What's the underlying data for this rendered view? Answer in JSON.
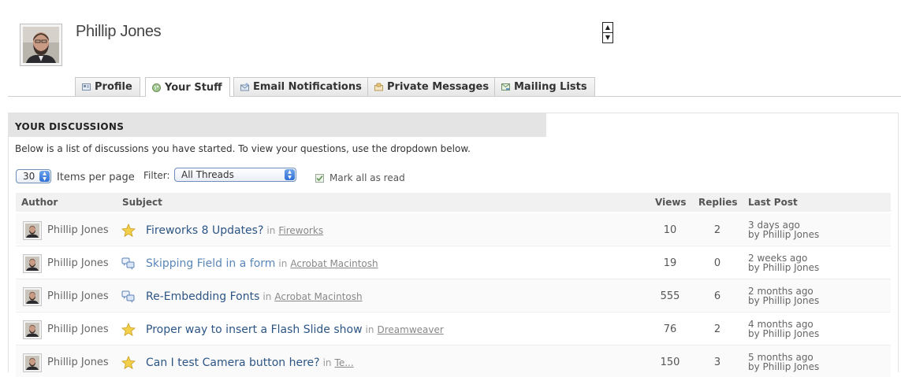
{
  "profile": {
    "name": "Phillip Jones"
  },
  "tabs": [
    {
      "label": "Profile",
      "icon": "profile-card-icon",
      "active": false
    },
    {
      "label": "Your Stuff",
      "icon": "globe-icon",
      "active": true
    },
    {
      "label": "Email Notifications",
      "icon": "email-icon",
      "active": false
    },
    {
      "label": "Private Messages",
      "icon": "private-message-icon",
      "active": false
    },
    {
      "label": "Mailing Lists",
      "icon": "mailing-list-icon",
      "active": false
    }
  ],
  "section": {
    "title": "YOUR DISCUSSIONS",
    "description": "Below is a list of discussions you have started. To view your questions, use the dropdown below."
  },
  "controls": {
    "per_page_value": "30",
    "per_page_label": "Items per page",
    "filter_label": "Filter:",
    "filter_value": "All Threads",
    "mark_all_label": "Mark all as read"
  },
  "table": {
    "headers": {
      "author": "Author",
      "subject": "Subject",
      "views": "Views",
      "replies": "Replies",
      "last_post": "Last Post"
    },
    "in_word": "in",
    "rows": [
      {
        "author": "Phillip Jones",
        "icon": "star-icon",
        "subject": "Fireworks 8 Updates?",
        "category": "Fireworks",
        "views": "10",
        "replies": "2",
        "last_when": "3 days ago",
        "last_by": "by Phillip Jones"
      },
      {
        "author": "Phillip Jones",
        "icon": "discussion-icon",
        "subject": "Skipping Field in a form",
        "category": "Acrobat Macintosh",
        "views": "19",
        "replies": "0",
        "last_when": "2 weeks ago",
        "last_by": "by Phillip Jones"
      },
      {
        "author": "Phillip Jones",
        "icon": "discussion-icon",
        "subject": "Re-Embedding Fonts",
        "category": "Acrobat Macintosh",
        "views": "555",
        "replies": "6",
        "last_when": "2 months ago",
        "last_by": "by Phillip Jones"
      },
      {
        "author": "Phillip Jones",
        "icon": "star-icon",
        "subject": "Proper way to insert a Flash Slide show",
        "category": "Dreamweaver",
        "views": "76",
        "replies": "2",
        "last_when": "4 months ago",
        "last_by": "by Phillip Jones"
      },
      {
        "author": "Phillip Jones",
        "icon": "star-icon",
        "subject": "Can I test Camera button here?",
        "category": "Te...",
        "views": "150",
        "replies": "3",
        "last_when": "5 months ago",
        "last_by": "by Phillip Jones"
      }
    ]
  }
}
